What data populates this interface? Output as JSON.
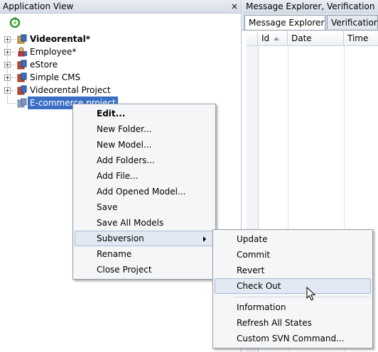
{
  "left_panel": {
    "title": "Application View",
    "close_glyph": "×",
    "refresh_icon": "refresh-icon",
    "tree": [
      {
        "label": "Videorental*",
        "bold": true,
        "icon": "project-icon"
      },
      {
        "label": "Employee*",
        "bold": false,
        "icon": "user-project-icon"
      },
      {
        "label": "eStore",
        "bold": false,
        "icon": "project-icon"
      },
      {
        "label": "Simple CMS",
        "bold": false,
        "icon": "project-icon"
      },
      {
        "label": "Videorental Project",
        "bold": false,
        "icon": "project-icon"
      },
      {
        "label": "E-commerce project",
        "bold": false,
        "icon": "svn-project-icon",
        "selected": true
      }
    ]
  },
  "right_panel": {
    "title": "Message Explorer, Verification Log",
    "tabs": [
      "Message Explorer",
      "Verification Lo"
    ],
    "tab_close": "×",
    "columns": [
      "Id",
      "Date",
      "Time"
    ]
  },
  "context_menu": {
    "items": [
      "Edit...",
      "New Folder...",
      "New Model...",
      "Add Folders...",
      "Add File...",
      "Add Opened Model...",
      "Save",
      "Save All Models",
      "Subversion",
      "Rename",
      "Close Project"
    ]
  },
  "submenu": {
    "items": [
      "Update",
      "Commit",
      "Revert",
      "Check Out",
      "Information",
      "Refresh All States",
      "Custom SVN Command..."
    ]
  },
  "colors": {
    "selection": "#3a6fc5",
    "menu_highlight": "#e2e9f3",
    "panel_header": "#d6dde8"
  }
}
